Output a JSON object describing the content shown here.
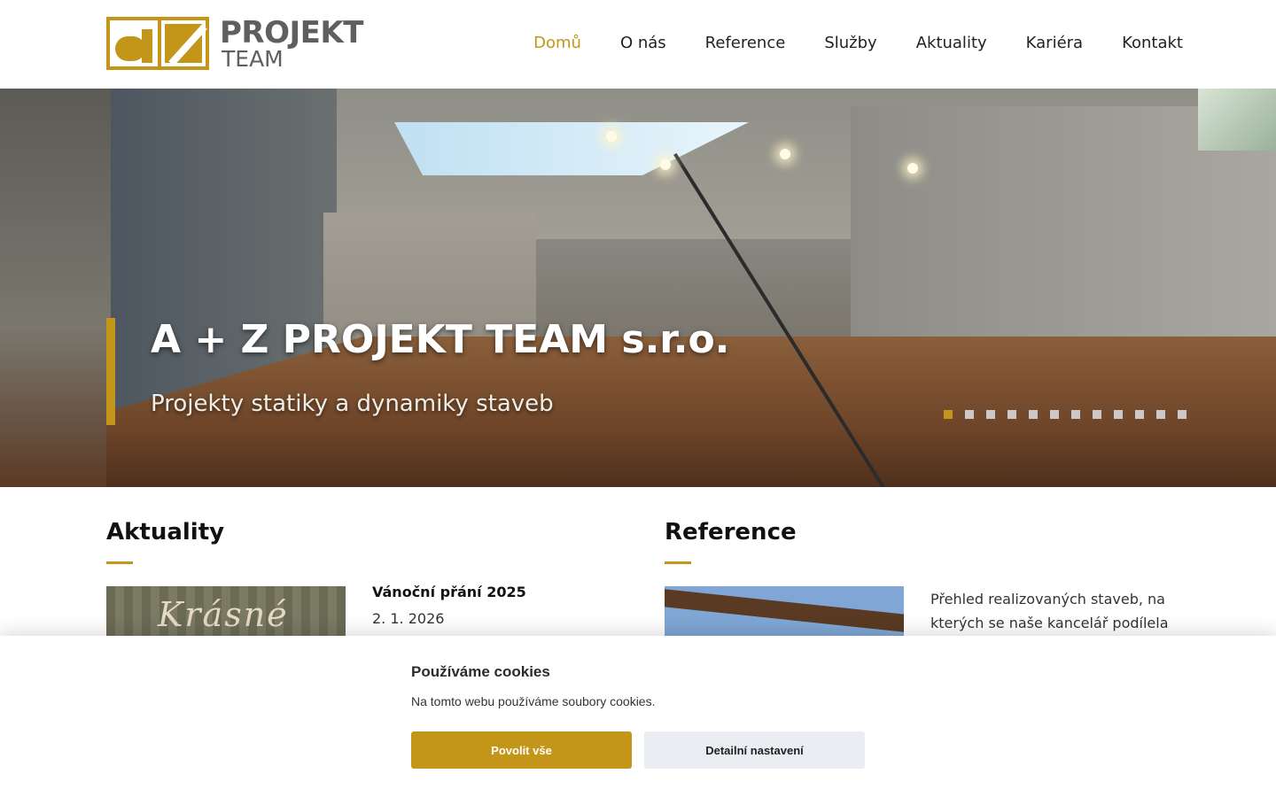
{
  "brand": {
    "logo_line1": "PROJEKT",
    "logo_line2": "TEAM",
    "accent_color": "#c3961a"
  },
  "nav": {
    "items": [
      {
        "label": "Domů",
        "active": true
      },
      {
        "label": "O nás"
      },
      {
        "label": "Reference"
      },
      {
        "label": "Služby"
      },
      {
        "label": "Aktuality"
      },
      {
        "label": "Kariéra"
      },
      {
        "label": "Kontakt"
      }
    ]
  },
  "hero": {
    "title": "A + Z PROJEKT TEAM s.r.o.",
    "subtitle": "Projekty statiky a dynamiky staveb",
    "slide_count": 12,
    "active_slide": 1
  },
  "news": {
    "heading": "Aktuality",
    "item": {
      "title": "Vánoční přání 2025",
      "date": "2. 1. 2026",
      "thumb_text": "Krásné"
    }
  },
  "references": {
    "heading": "Reference",
    "text": "Přehled realizovaných staveb, na kterých se naše kancelář podílela"
  },
  "cookies": {
    "title": "Používáme cookies",
    "text": "Na tomto webu používáme soubory cookies.",
    "accept_label": "Povolit vše",
    "detail_label": "Detailní nastavení"
  }
}
